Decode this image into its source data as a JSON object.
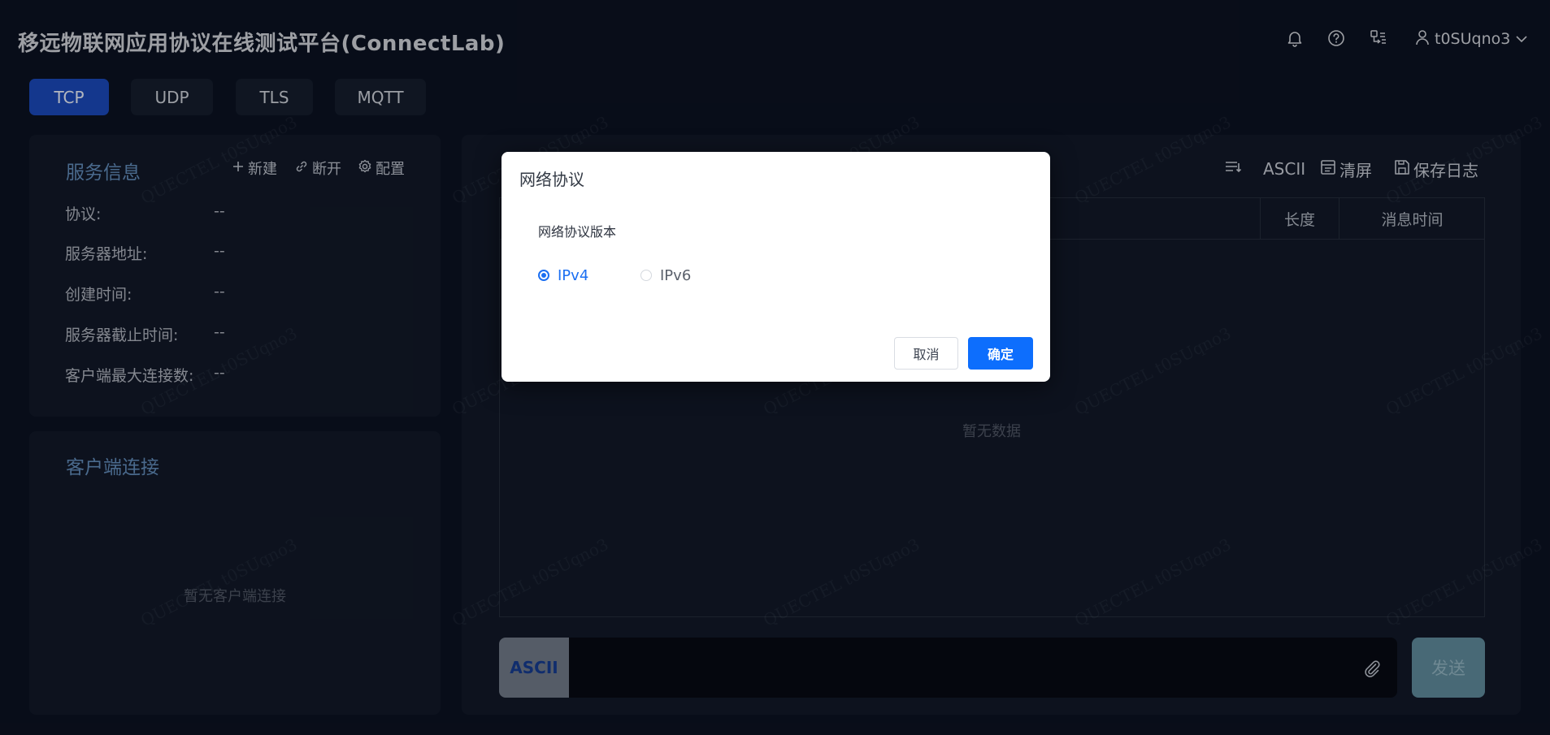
{
  "header": {
    "title": "移远物联网应用协议在线测试平台(ConnectLab)",
    "username": "t0SUqno3",
    "icons": [
      "bell-icon",
      "help-icon",
      "switch-icon",
      "user-icon",
      "chevron-down-icon"
    ]
  },
  "tabs": [
    {
      "label": "TCP",
      "active": true
    },
    {
      "label": "UDP",
      "active": false
    },
    {
      "label": "TLS",
      "active": false
    },
    {
      "label": "MQTT",
      "active": false
    }
  ],
  "service_info": {
    "title": "服务信息",
    "actions": {
      "new": "新建",
      "disconnect": "断开",
      "config": "配置"
    },
    "rows": [
      {
        "label": "协议:",
        "value": "--"
      },
      {
        "label": "服务器地址:",
        "value": "--"
      },
      {
        "label": "创建时间:",
        "value": "--"
      },
      {
        "label": "服务器截止时间:",
        "value": "--"
      },
      {
        "label": "客户端最大连接数:",
        "value": "--"
      }
    ]
  },
  "clients": {
    "title": "客户端连接",
    "empty": "暂无客户端连接"
  },
  "log": {
    "tools": {
      "format": "ASCII",
      "clear": "清屏",
      "save": "保存日志"
    },
    "columns": {
      "length": "长度",
      "time": "消息时间"
    },
    "empty": "暂无数据"
  },
  "send": {
    "mode": "ASCII",
    "input_value": "",
    "button": "发送"
  },
  "watermark": "QUECTEL t0SUqno3",
  "dialog": {
    "title": "网络协议",
    "field_label": "网络协议版本",
    "options": [
      {
        "label": "IPv4",
        "selected": true
      },
      {
        "label": "IPv6",
        "selected": false
      }
    ],
    "cancel": "取消",
    "confirm": "确定"
  },
  "colors": {
    "accent": "#0d6efd",
    "active_tab": "#1a47b5",
    "panel_title": "#5f88b5",
    "background": "#0b1120"
  }
}
